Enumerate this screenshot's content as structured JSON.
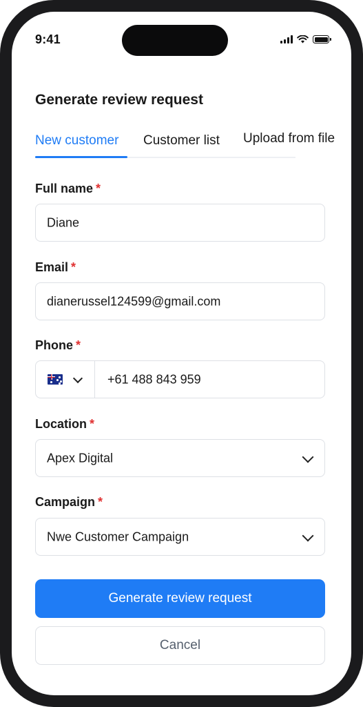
{
  "status_bar": {
    "time": "9:41",
    "icons": [
      "signal-icon",
      "wifi-icon",
      "battery-icon"
    ]
  },
  "page": {
    "title": "Generate review request"
  },
  "tabs": [
    {
      "label": "New customer",
      "active": true
    },
    {
      "label": "Customer list",
      "active": false
    },
    {
      "label": "Upload from file",
      "active": false
    }
  ],
  "form": {
    "required_marker": "*",
    "full_name": {
      "label": "Full name",
      "value": "Diane"
    },
    "email": {
      "label": "Email",
      "value": "dianerussel124599@gmail.com"
    },
    "phone": {
      "label": "Phone",
      "country_flag": "australia-flag-icon",
      "value": "+61 488 843 959"
    },
    "location": {
      "label": "Location",
      "value": "Apex Digital"
    },
    "campaign": {
      "label": "Campaign",
      "value": "Nwe Customer Campaign"
    }
  },
  "actions": {
    "primary_label": "Generate review request",
    "secondary_label": "Cancel"
  },
  "colors": {
    "accent": "#1f7cf5",
    "required": "#e03131",
    "border": "#dde0e5",
    "frame": "#1b1b1d"
  }
}
